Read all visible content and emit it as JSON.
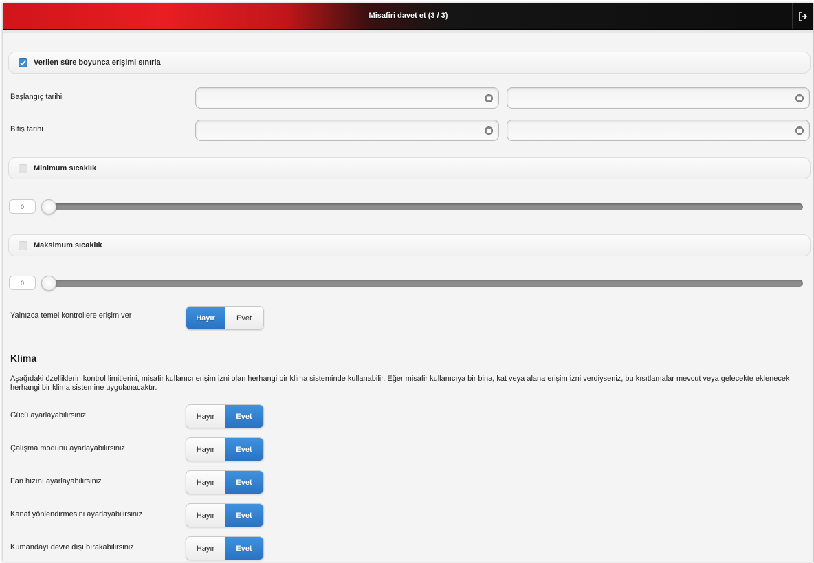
{
  "header": {
    "title": "Misafiri davet et (3 / 3)",
    "exit_icon": "logout-icon"
  },
  "limit_access": {
    "label": "Verilen süre boyunca erişimi sınırla",
    "checked": true
  },
  "start_date": {
    "label": "Başlangıç tarihi",
    "date_value": "",
    "time_value": ""
  },
  "end_date": {
    "label": "Bitiş tarihi",
    "date_value": "",
    "time_value": ""
  },
  "min_temp": {
    "label": "Minimum sıcaklık",
    "checked": false,
    "value": "0"
  },
  "max_temp": {
    "label": "Maksimum sıcaklık",
    "checked": false,
    "value": "0"
  },
  "basic_controls": {
    "label": "Yalnızca temel kontrollere erişim ver",
    "no": "Hayır",
    "yes": "Evet",
    "selected": "no"
  },
  "klima": {
    "title": "Klima",
    "description": "Aşağıdaki özelliklerin kontrol limitlerini, misafir kullanıcı erişim izni olan herhangi bir klima sisteminde kullanabilir. Eğer misafir kullanıcıya bir bina, kat veya alana erişim izni verdiyseniz, bu kısıtlamalar mevcut veya gelecekte eklenecek herhangi bir klima sistemine uygulanacaktır.",
    "options": [
      {
        "label": "Gücü ayarlayabilirsiniz",
        "no": "Hayır",
        "yes": "Evet",
        "selected": "yes"
      },
      {
        "label": "Çalışma modunu ayarlayabilirsiniz",
        "no": "Hayır",
        "yes": "Evet",
        "selected": "yes"
      },
      {
        "label": "Fan hızını ayarlayabilirsiniz",
        "no": "Hayır",
        "yes": "Evet",
        "selected": "yes"
      },
      {
        "label": "Kanat yönlendirmesini ayarlayabilirsiniz",
        "no": "Hayır",
        "yes": "Evet",
        "selected": "yes"
      },
      {
        "label": "Kumandayı devre dışı bırakabilirsiniz",
        "no": "Hayır",
        "yes": "Evet",
        "selected": "yes"
      }
    ]
  },
  "colors": {
    "accent": "#2f7fce",
    "header_red": "#e0181d",
    "header_dark": "#111111"
  }
}
